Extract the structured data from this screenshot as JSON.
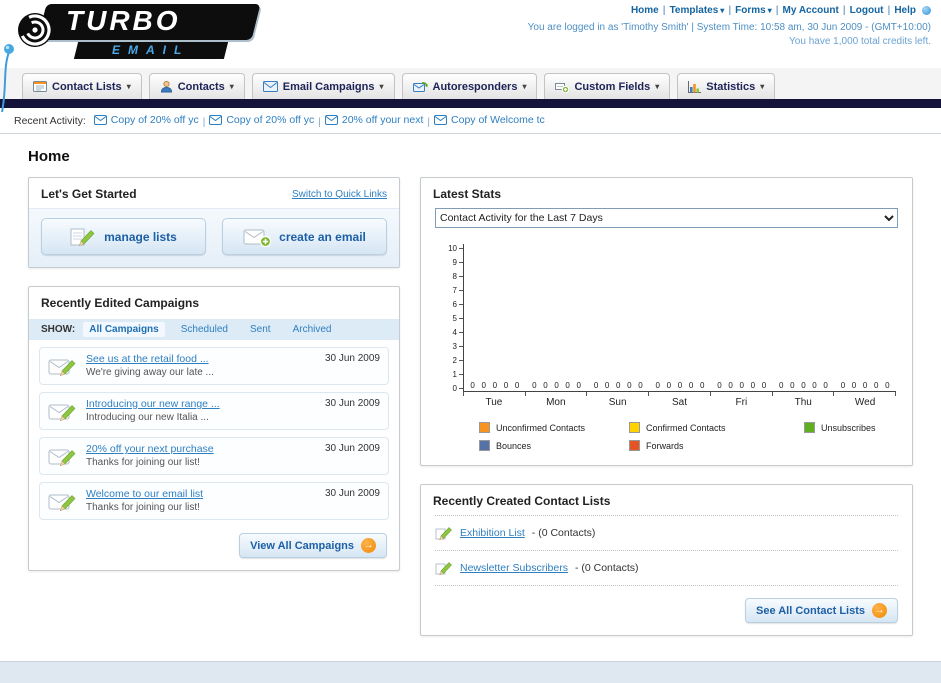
{
  "header": {
    "logo": {
      "main": "TURBO",
      "sub": "EMAIL"
    },
    "nav": [
      {
        "label": "Home",
        "caret": false
      },
      {
        "label": "Templates",
        "caret": true
      },
      {
        "label": "Forms",
        "caret": true
      },
      {
        "label": "My Account",
        "caret": false
      },
      {
        "label": "Logout",
        "caret": false
      },
      {
        "label": "Help",
        "caret": false
      }
    ],
    "login_line": "You are logged in as 'Timothy Smith' | System Time: 10:58 am, 30 Jun 2009 - (GMT+10:00)",
    "credits_line": "You have 1,000 total credits left."
  },
  "tabs": [
    {
      "label": "Contact Lists",
      "icon": "contact-lists-icon"
    },
    {
      "label": "Contacts",
      "icon": "contacts-icon"
    },
    {
      "label": "Email Campaigns",
      "icon": "email-campaigns-icon"
    },
    {
      "label": "Autoresponders",
      "icon": "autoresponders-icon"
    },
    {
      "label": "Custom Fields",
      "icon": "custom-fields-icon"
    },
    {
      "label": "Statistics",
      "icon": "statistics-icon"
    }
  ],
  "activity": {
    "label": "Recent Activity:",
    "items": [
      "Copy of 20% off yc",
      "Copy of 20% off yc",
      "20% off your next",
      "Copy of Welcome tc"
    ]
  },
  "page_title": "Home",
  "get_started": {
    "title": "Let's Get Started",
    "switch_link": "Switch to Quick Links",
    "manage_lists": "manage lists",
    "create_email": "create an email"
  },
  "campaigns": {
    "title": "Recently Edited Campaigns",
    "show_label": "SHOW:",
    "filters": [
      "All Campaigns",
      "Scheduled",
      "Sent",
      "Archived"
    ],
    "active_filter": "All Campaigns",
    "items": [
      {
        "title": "See us at the retail food ...",
        "subtitle": "We're giving away our late ...",
        "date": "30 Jun 2009"
      },
      {
        "title": "Introducing our new range ...",
        "subtitle": "Introducing our new Italia ...",
        "date": "30 Jun 2009"
      },
      {
        "title": "20% off your next purchase",
        "subtitle": "Thanks for joining our list!",
        "date": "30 Jun 2009"
      },
      {
        "title": "Welcome to our email list",
        "subtitle": "Thanks for joining our list!",
        "date": "30 Jun 2009"
      }
    ],
    "view_all": "View All Campaigns"
  },
  "stats": {
    "title": "Latest Stats",
    "range_selector": "Contact Activity for the Last 7 Days"
  },
  "chart_data": {
    "type": "bar",
    "title": "Contact Activity for the Last 7 Days",
    "categories": [
      "Tue",
      "Mon",
      "Sun",
      "Sat",
      "Fri",
      "Thu",
      "Wed"
    ],
    "series": [
      {
        "name": "Unconfirmed Contacts",
        "color": "#f7941d",
        "values": [
          0,
          0,
          0,
          0,
          0,
          0,
          0
        ]
      },
      {
        "name": "Confirmed Contacts",
        "color": "#ffd200",
        "values": [
          0,
          0,
          0,
          0,
          0,
          0,
          0
        ]
      },
      {
        "name": "Unsubscribes",
        "color": "#5faf1e",
        "values": [
          0,
          0,
          0,
          0,
          0,
          0,
          0
        ]
      },
      {
        "name": "Bounces",
        "color": "#5572a8",
        "values": [
          0,
          0,
          0,
          0,
          0,
          0,
          0
        ]
      },
      {
        "name": "Forwards",
        "color": "#e65325",
        "values": [
          0,
          0,
          0,
          0,
          0,
          0,
          0
        ]
      }
    ],
    "ylim": [
      0,
      10
    ],
    "yticks": [
      0,
      1,
      2,
      3,
      4,
      5,
      6,
      7,
      8,
      9,
      10
    ],
    "legend_position": "bottom",
    "grid": false
  },
  "contact_lists": {
    "title": "Recently Created Contact Lists",
    "items": [
      {
        "name": "Exhibition List",
        "detail": "- (0 Contacts)"
      },
      {
        "name": "Newsletter Subscribers",
        "detail": "- (0 Contacts)"
      }
    ],
    "see_all": "See All Contact Lists"
  },
  "icons": {
    "caret-down": "▾",
    "arrow-right": "→",
    "separator": "|"
  }
}
